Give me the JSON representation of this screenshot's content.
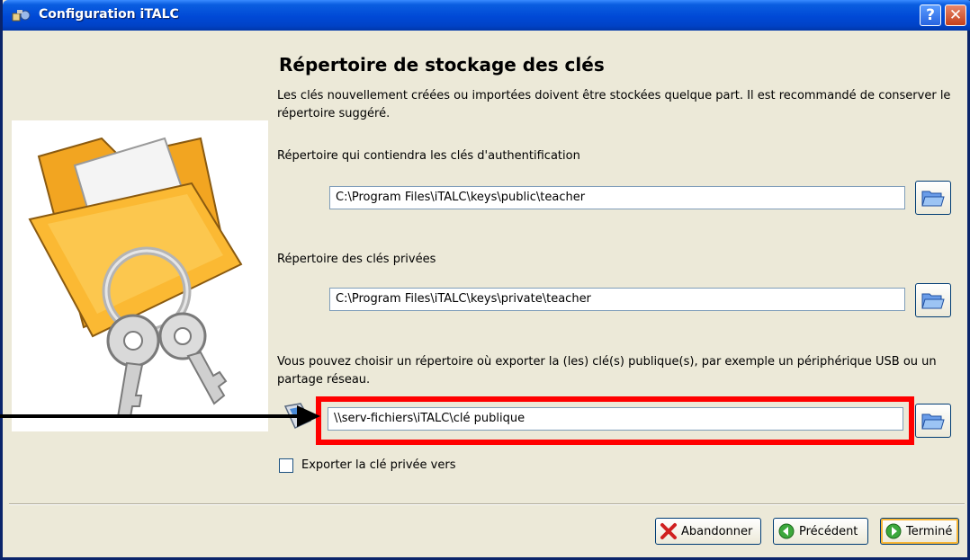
{
  "window": {
    "title": "Configuration iTALC",
    "help_label": "?",
    "close_label": "✕"
  },
  "page": {
    "heading": "Répertoire de stockage des clés",
    "description": "Les clés nouvellement créées ou importées doivent être stockées quelque part. Il est recommandé de conserver le répertoire suggéré."
  },
  "fields": {
    "auth_label": "Répertoire qui contiendra les clés d'authentification",
    "auth_value": "C:\\Program Files\\iTALC\\keys\\public\\teacher",
    "private_label": "Répertoire des clés privées",
    "private_value": "C:\\Program Files\\iTALC\\keys\\private\\teacher",
    "export_label": "Vous pouvez choisir un répertoire où exporter la (les) clé(s) publique(s), par exemple un périphérique USB ou un partage réseau.",
    "export_value": "\\\\serv-fichiers\\iTALC\\clé publique",
    "export_private_checkbox": "Exporter la clé privée vers",
    "export_private_checked": false
  },
  "buttons": {
    "cancel": "Abandonner",
    "back": "Précédent",
    "finish": "Terminé"
  },
  "icons": [
    "folder-keys-icon",
    "usb-icon",
    "open-folder-icon",
    "cancel-icon",
    "back-icon",
    "finish-icon"
  ],
  "colors": {
    "titlebar": "#0049d6",
    "highlight": "#ff0000",
    "dialog_bg": "#ece9d8"
  }
}
